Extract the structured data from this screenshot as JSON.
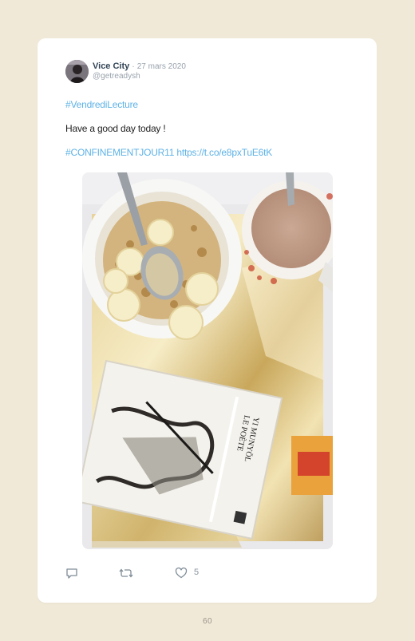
{
  "tweet": {
    "display_name": "Vice City",
    "separator": "·",
    "date": "27 mars 2020",
    "handle": "@getreadysh",
    "hashtag_line": "#VendrediLecture",
    "body_line": "Have a good day today !",
    "tags_line_hashtag": "#CONFINEMENTJOUR11",
    "tags_line_link": "https://t.co/e8pxTuE6tK",
    "like_count": "5"
  },
  "photo_book": {
    "title_line1": "YI MUNYŎL",
    "title_line2": "LE POÈTE"
  },
  "page": {
    "number": "60"
  },
  "colors": {
    "background": "#f1e9d8",
    "card": "#ffffff",
    "hashtag": "#5eb2e6",
    "name": "#334556",
    "muted": "#98a2ac"
  },
  "icons": {
    "reply": "speech-bubble-icon",
    "retweet": "retweet-icon",
    "like": "heart-icon"
  }
}
